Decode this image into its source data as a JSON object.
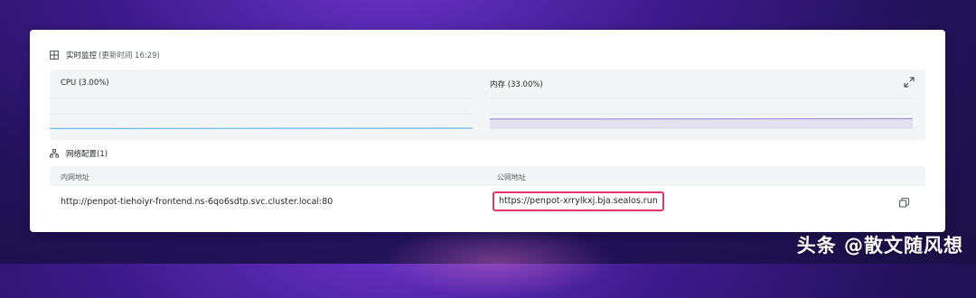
{
  "monitor": {
    "title": "实时监控",
    "update_time": "(更新时间 16:29)",
    "cpu": {
      "label": "CPU (3.00%)",
      "value": 3.0,
      "color": "#5fb6e8"
    },
    "memory": {
      "label": "内存 (33.00%)",
      "value": 33.0,
      "color": "#9b8ad6"
    },
    "expand_icon": "expand-icon"
  },
  "network": {
    "title": "网络配置(1)",
    "columns": {
      "internal": "内网地址",
      "public": "公网地址"
    },
    "row": {
      "internal_address": "http://penpot-tiehoiyr-frontend.ns-6qo6sdtp.svc.cluster.local:80",
      "public_address": "https://penpot-xrrylkxj.bja.sealos.run"
    },
    "highlight_color": "#e4356a",
    "copy_icon": "copy-icon"
  },
  "watermark": "头条 @散文随风想"
}
